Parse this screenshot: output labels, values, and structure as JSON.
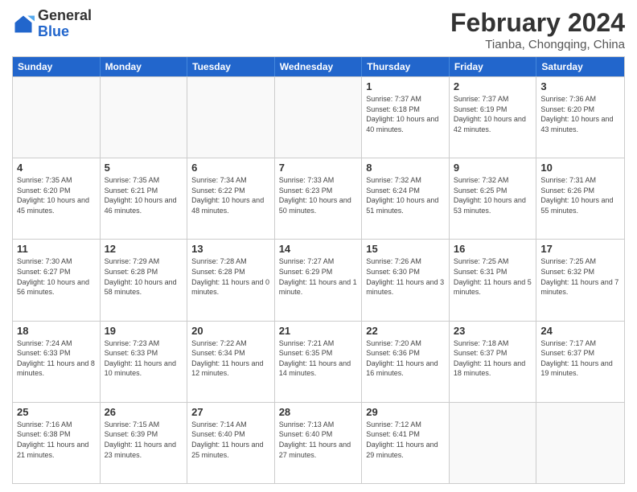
{
  "logo": {
    "general": "General",
    "blue": "Blue"
  },
  "header": {
    "month_year": "February 2024",
    "location": "Tianba, Chongqing, China"
  },
  "days_of_week": [
    "Sunday",
    "Monday",
    "Tuesday",
    "Wednesday",
    "Thursday",
    "Friday",
    "Saturday"
  ],
  "weeks": [
    [
      {
        "day": "",
        "empty": true
      },
      {
        "day": "",
        "empty": true
      },
      {
        "day": "",
        "empty": true
      },
      {
        "day": "",
        "empty": true
      },
      {
        "day": "1",
        "sunrise": "7:37 AM",
        "sunset": "6:18 PM",
        "daylight": "10 hours and 40 minutes."
      },
      {
        "day": "2",
        "sunrise": "7:37 AM",
        "sunset": "6:19 PM",
        "daylight": "10 hours and 42 minutes."
      },
      {
        "day": "3",
        "sunrise": "7:36 AM",
        "sunset": "6:20 PM",
        "daylight": "10 hours and 43 minutes."
      }
    ],
    [
      {
        "day": "4",
        "sunrise": "7:35 AM",
        "sunset": "6:20 PM",
        "daylight": "10 hours and 45 minutes."
      },
      {
        "day": "5",
        "sunrise": "7:35 AM",
        "sunset": "6:21 PM",
        "daylight": "10 hours and 46 minutes."
      },
      {
        "day": "6",
        "sunrise": "7:34 AM",
        "sunset": "6:22 PM",
        "daylight": "10 hours and 48 minutes."
      },
      {
        "day": "7",
        "sunrise": "7:33 AM",
        "sunset": "6:23 PM",
        "daylight": "10 hours and 50 minutes."
      },
      {
        "day": "8",
        "sunrise": "7:32 AM",
        "sunset": "6:24 PM",
        "daylight": "10 hours and 51 minutes."
      },
      {
        "day": "9",
        "sunrise": "7:32 AM",
        "sunset": "6:25 PM",
        "daylight": "10 hours and 53 minutes."
      },
      {
        "day": "10",
        "sunrise": "7:31 AM",
        "sunset": "6:26 PM",
        "daylight": "10 hours and 55 minutes."
      }
    ],
    [
      {
        "day": "11",
        "sunrise": "7:30 AM",
        "sunset": "6:27 PM",
        "daylight": "10 hours and 56 minutes."
      },
      {
        "day": "12",
        "sunrise": "7:29 AM",
        "sunset": "6:28 PM",
        "daylight": "10 hours and 58 minutes."
      },
      {
        "day": "13",
        "sunrise": "7:28 AM",
        "sunset": "6:28 PM",
        "daylight": "11 hours and 0 minutes."
      },
      {
        "day": "14",
        "sunrise": "7:27 AM",
        "sunset": "6:29 PM",
        "daylight": "11 hours and 1 minute."
      },
      {
        "day": "15",
        "sunrise": "7:26 AM",
        "sunset": "6:30 PM",
        "daylight": "11 hours and 3 minutes."
      },
      {
        "day": "16",
        "sunrise": "7:25 AM",
        "sunset": "6:31 PM",
        "daylight": "11 hours and 5 minutes."
      },
      {
        "day": "17",
        "sunrise": "7:25 AM",
        "sunset": "6:32 PM",
        "daylight": "11 hours and 7 minutes."
      }
    ],
    [
      {
        "day": "18",
        "sunrise": "7:24 AM",
        "sunset": "6:33 PM",
        "daylight": "11 hours and 8 minutes."
      },
      {
        "day": "19",
        "sunrise": "7:23 AM",
        "sunset": "6:33 PM",
        "daylight": "11 hours and 10 minutes."
      },
      {
        "day": "20",
        "sunrise": "7:22 AM",
        "sunset": "6:34 PM",
        "daylight": "11 hours and 12 minutes."
      },
      {
        "day": "21",
        "sunrise": "7:21 AM",
        "sunset": "6:35 PM",
        "daylight": "11 hours and 14 minutes."
      },
      {
        "day": "22",
        "sunrise": "7:20 AM",
        "sunset": "6:36 PM",
        "daylight": "11 hours and 16 minutes."
      },
      {
        "day": "23",
        "sunrise": "7:18 AM",
        "sunset": "6:37 PM",
        "daylight": "11 hours and 18 minutes."
      },
      {
        "day": "24",
        "sunrise": "7:17 AM",
        "sunset": "6:37 PM",
        "daylight": "11 hours and 19 minutes."
      }
    ],
    [
      {
        "day": "25",
        "sunrise": "7:16 AM",
        "sunset": "6:38 PM",
        "daylight": "11 hours and 21 minutes."
      },
      {
        "day": "26",
        "sunrise": "7:15 AM",
        "sunset": "6:39 PM",
        "daylight": "11 hours and 23 minutes."
      },
      {
        "day": "27",
        "sunrise": "7:14 AM",
        "sunset": "6:40 PM",
        "daylight": "11 hours and 25 minutes."
      },
      {
        "day": "28",
        "sunrise": "7:13 AM",
        "sunset": "6:40 PM",
        "daylight": "11 hours and 27 minutes."
      },
      {
        "day": "29",
        "sunrise": "7:12 AM",
        "sunset": "6:41 PM",
        "daylight": "11 hours and 29 minutes."
      },
      {
        "day": "",
        "empty": true
      },
      {
        "day": "",
        "empty": true
      }
    ]
  ]
}
